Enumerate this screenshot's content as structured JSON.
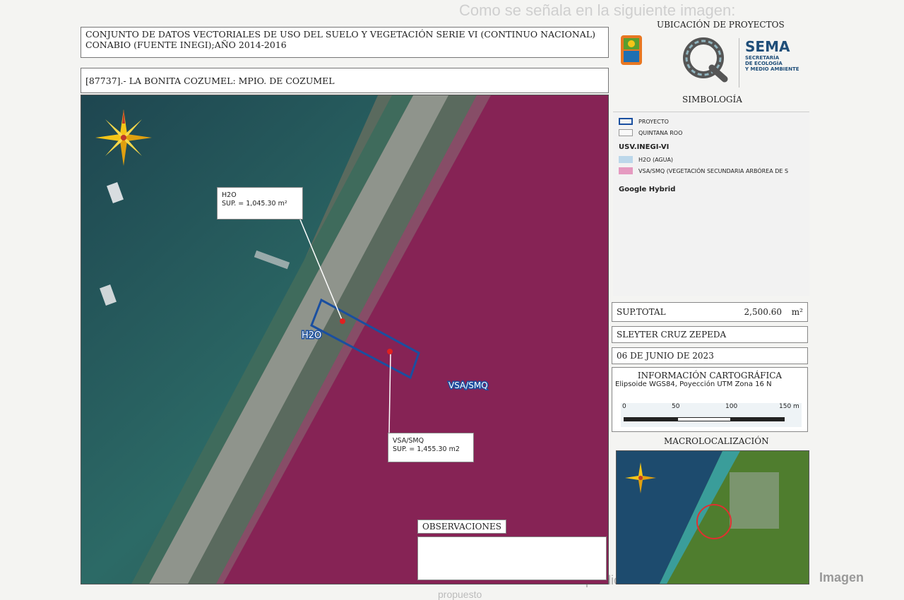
{
  "background_text": {
    "top": "Como se señala en la siguiente imagen:",
    "bottom_left": "Imagen",
    "bottom_mid": "del predio conforme",
    "bottom_mid2": "propuesto"
  },
  "header": {
    "title": "CONJUNTO DE DATOS VECTORIALES DE USO DEL SUELO Y VEGETACIÓN SERIE VI (CONTINUO NACIONAL) CONABIO (FUENTE INEGI);AÑO 2014-2016",
    "subtitle": "[87737].- LA BONITA COZUMEL: MPIO. DE COZUMEL"
  },
  "branding": {
    "location_title": "UBICACIÓN DE PROYECTOS",
    "sema": "SEMA",
    "sema_sub": [
      "SECRETARÍA",
      "DE ECOLOGÍA",
      "Y MEDIO AMBIENTE"
    ],
    "colors": {
      "sema_blue": "#1f4e79",
      "state_green": "#5a9e2f",
      "state_orange": "#e87722"
    }
  },
  "legend": {
    "title": "SIMBOLOGÍA",
    "items": [
      {
        "label": "PROYECTO",
        "color": "#1a4fa0",
        "style": "outline"
      },
      {
        "label": "QUINTANA ROO",
        "color": "#cccccc",
        "style": "outline"
      }
    ],
    "group_title": "USV.INEGI-VI",
    "group_items": [
      {
        "label": "H2O (AGUA)",
        "color": "#bcd7ea"
      },
      {
        "label": "VSA/SMQ (VEGETACIÓN SECUNDARIA ARBÓREA DE S",
        "color": "#e59ac0"
      }
    ],
    "basemap": "Google Hybrid"
  },
  "info": {
    "sup_total_label": "SUP.TOTAL",
    "sup_total_value": "2,500.60",
    "sup_total_unit": "m²",
    "author": "SLEYTER CRUZ ZEPEDA",
    "date": "06 DE JUNIO DE 2023",
    "carto_title": "INFORMACIÓN CARTOGRÁFICA",
    "carto_desc": "Elipsoide WGS84, Poyección UTM Zona 16 N",
    "scale_ticks": [
      "0",
      "50",
      "100",
      "150 m"
    ],
    "macro_title": "MACROLOCALIZACIÓN"
  },
  "map": {
    "zones": {
      "water": "H2O",
      "vegetation": "VSA/SMQ"
    },
    "callouts": [
      {
        "line1": "H2O",
        "line2": "SUP. = 1,045.30  m²"
      },
      {
        "line1": "VSA/SMQ",
        "line2": "SUP. = 1,455.30  m2"
      }
    ],
    "colors": {
      "water": "#1d4f57",
      "vegetation": "#8a1d55",
      "project": "#1a4fa0"
    }
  },
  "observations": {
    "label": "OBSERVACIONES"
  }
}
